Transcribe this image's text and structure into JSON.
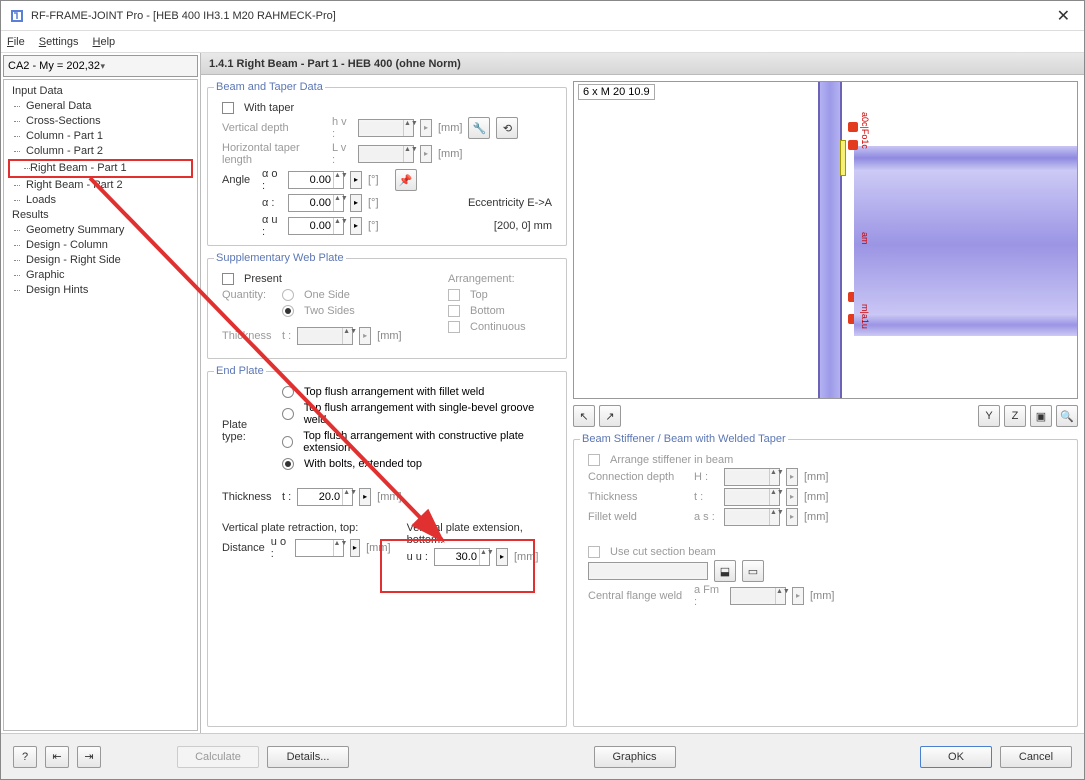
{
  "window": {
    "title": "RF-FRAME-JOINT Pro - [HEB 400 IH3.1 M20 RAHMECK-Pro]"
  },
  "menu": {
    "file": "File",
    "settings": "Settings",
    "help": "Help"
  },
  "dropdown": {
    "value": "CA2 - My = 202,32"
  },
  "tree": {
    "input_data": "Input Data",
    "general_data": "General Data",
    "cross_sections": "Cross-Sections",
    "column_part1": "Column - Part 1",
    "column_part2": "Column - Part 2",
    "right_beam_part1": "Right Beam - Part 1",
    "right_beam_part2": "Right Beam - Part 2",
    "loads": "Loads",
    "results": "Results",
    "geom_summary": "Geometry Summary",
    "design_column": "Design - Column",
    "design_right": "Design - Right Side",
    "graphic": "Graphic",
    "design_hints": "Design Hints"
  },
  "header": {
    "text": "1.4.1 Right Beam - Part 1 - HEB 400 (ohne Norm)"
  },
  "beam_taper": {
    "title": "Beam and Taper Data",
    "with_taper": "With taper",
    "vertical_depth": "Vertical depth",
    "hv": "h v :",
    "horiz_len": "Horizontal taper length",
    "lv": "L v :",
    "angle": "Angle",
    "ao": "α o :",
    "a": "α :",
    "au": "α u :",
    "ao_val": "0.00",
    "a_val": "0.00",
    "au_val": "0.00",
    "deg": "[°]",
    "mm": "[mm]",
    "ecc": "Eccentricity E->A",
    "ecc_val": "[200, 0] mm"
  },
  "web_plate": {
    "title": "Supplementary Web Plate",
    "present": "Present",
    "quantity": "Quantity:",
    "one": "One Side",
    "two": "Two Sides",
    "thickness": "Thickness",
    "t": "t :",
    "mm": "[mm]",
    "arrangement": "Arrangement:",
    "top": "Top",
    "bottom": "Bottom",
    "cont": "Continuous"
  },
  "end_plate": {
    "title": "End Plate",
    "plate_type": "Plate type:",
    "opt1": "Top flush arrangement with fillet weld",
    "opt2": "Top flush arrangement with single-bevel groove weld",
    "opt3": "Top flush arrangement with constructive plate extension",
    "opt4": "With bolts, extended top",
    "thickness": "Thickness",
    "t": "t :",
    "t_val": "20.0",
    "mm": "[mm]",
    "retraction": "Vertical plate retraction, top:",
    "distance": "Distance",
    "uo": "u o :",
    "extension": "Vertical plate extension, bottom:",
    "uu": "u u :",
    "uu_val": "30.0"
  },
  "viewer": {
    "label": "6 x M 20 10.9"
  },
  "stiffener": {
    "title": "Beam Stiffener / Beam with Welded Taper",
    "arrange": "Arrange stiffener in beam",
    "conn_depth": "Connection depth",
    "H": "H :",
    "thickness": "Thickness",
    "t": "t :",
    "fillet": "Fillet weld",
    "as": "a s :",
    "mm": "[mm]",
    "cut": "Use cut section beam",
    "central_flange": "Central flange weld",
    "afm": "a Fm :"
  },
  "footer": {
    "calculate": "Calculate",
    "details": "Details...",
    "graphics": "Graphics",
    "ok": "OK",
    "cancel": "Cancel"
  }
}
